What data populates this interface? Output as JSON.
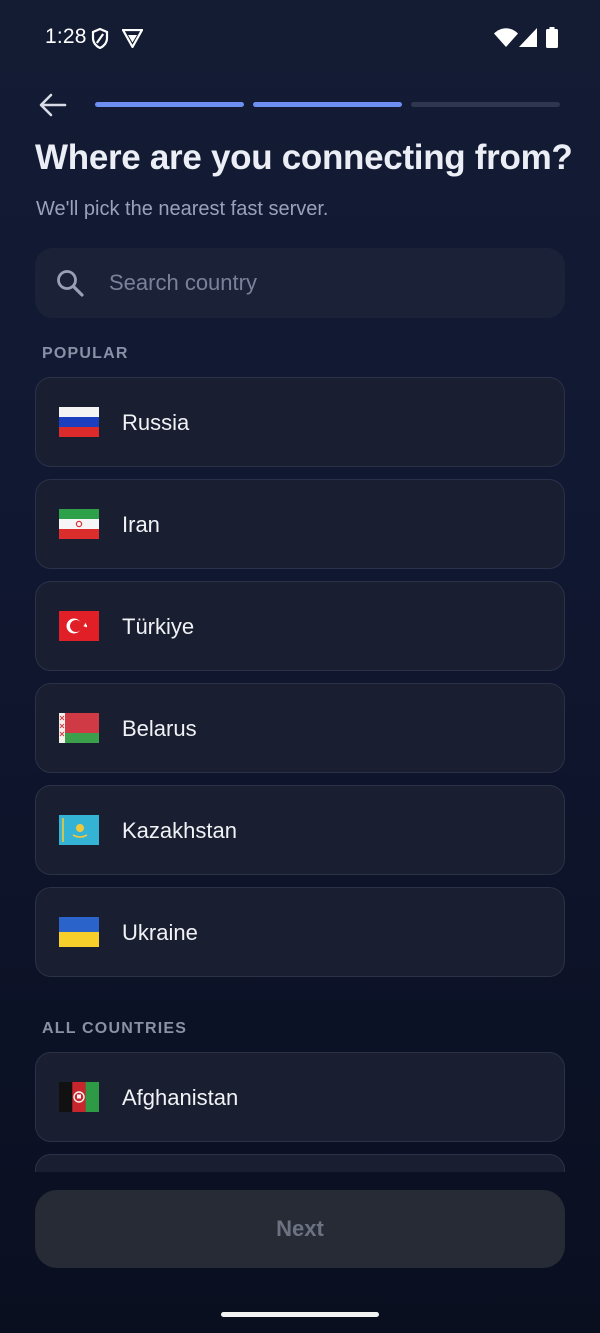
{
  "status_bar": {
    "time": "1:28",
    "icons": [
      "shield-icon",
      "vpn-icon",
      "wifi-icon",
      "signal-icon",
      "battery-icon"
    ]
  },
  "header": {
    "back_icon": "arrow-left-icon",
    "progress_steps": [
      {
        "state": "complete",
        "color": "#6d8ff2"
      },
      {
        "state": "complete",
        "color": "#6d8ff2"
      },
      {
        "state": "incomplete",
        "color": "#2f3650"
      }
    ]
  },
  "title": "Where are you connecting from?",
  "subtitle": "We'll pick the nearest fast server.",
  "search": {
    "icon": "search-icon",
    "placeholder": "Search country",
    "value": ""
  },
  "sections": {
    "popular_label": "POPULAR",
    "all_label": "ALL COUNTRIES"
  },
  "popular_countries": [
    {
      "name": "Russia",
      "flag": "flag-russia-icon"
    },
    {
      "name": "Iran",
      "flag": "flag-iran-icon"
    },
    {
      "name": "Türkiye",
      "flag": "flag-turkiye-icon"
    },
    {
      "name": "Belarus",
      "flag": "flag-belarus-icon"
    },
    {
      "name": "Kazakhstan",
      "flag": "flag-kazakhstan-icon"
    },
    {
      "name": "Ukraine",
      "flag": "flag-ukraine-icon"
    }
  ],
  "all_countries": [
    {
      "name": "Afghanistan",
      "flag": "flag-afghanistan-icon"
    }
  ],
  "next_button": {
    "label": "Next",
    "enabled": false
  },
  "colors": {
    "accent": "#6d8ff2",
    "background": "#111832",
    "card": "#191f30",
    "card_border": "#2b3247"
  }
}
